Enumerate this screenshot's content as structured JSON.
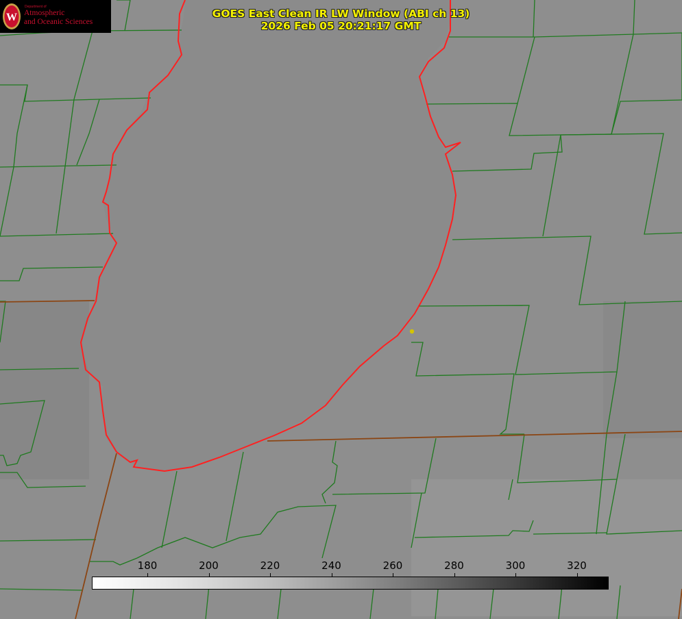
{
  "logo": {
    "department": "Department of",
    "line1": "Atmospheric",
    "line2": "and Oceanic Sciences",
    "seal_letter": "W"
  },
  "title": {
    "line1": "GOES East Clean IR LW Window (ABI ch 13)",
    "line2": "2026 Feb 05 20:21:17 GMT"
  },
  "colorbar": {
    "ticks": [
      "180",
      "200",
      "220",
      "240",
      "260",
      "280",
      "300",
      "320"
    ],
    "colormap": "white-to-black"
  },
  "colors": {
    "title": "#f5f200",
    "county_lines": "#1f7a1f",
    "state_lines": "#8b4513",
    "lake_outline": "#ff2020",
    "background_gray": "#8f8f8f",
    "marker": "#d4c400"
  }
}
